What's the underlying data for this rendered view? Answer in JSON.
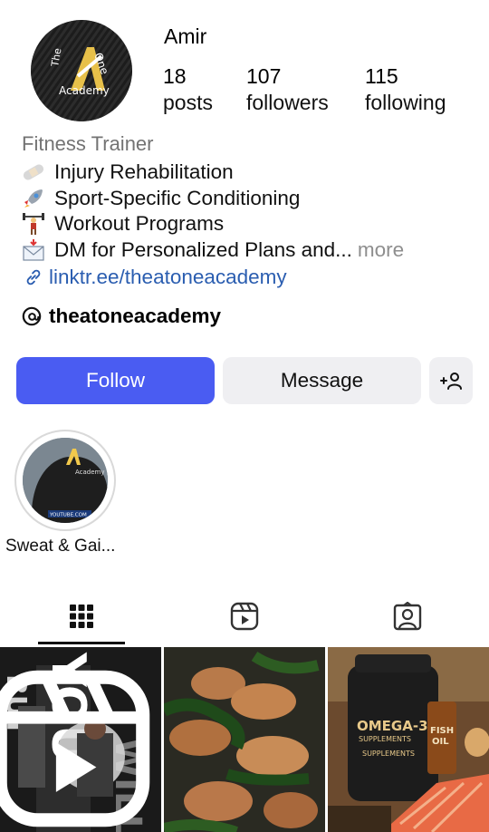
{
  "profile": {
    "username": "Amir",
    "avatar_text": "Academy",
    "avatar_the": "The",
    "avatar_one": "One"
  },
  "stats": {
    "posts_count": "18",
    "posts_label": "posts",
    "followers_count": "107",
    "followers_label": "followers",
    "following_count": "115",
    "following_label": "following"
  },
  "bio": {
    "category": "Fitness Trainer",
    "lines": [
      {
        "icon": "bandage-icon",
        "text": "Injury Rehabilitation"
      },
      {
        "icon": "rocket-icon",
        "text": "Sport-Specific Conditioning"
      },
      {
        "icon": "weightlifter-icon",
        "text": "Workout Programs"
      },
      {
        "icon": "envelope-icon",
        "text": "DM for Personalized Plans and..."
      }
    ],
    "more_label": "more",
    "link": "linktr.ee/theatoneacademy"
  },
  "threads": {
    "handle": "theatoneacademy"
  },
  "actions": {
    "follow_label": "Follow",
    "message_label": "Message",
    "add_user_icon": "add-user-icon"
  },
  "highlights": [
    {
      "label": "Sweat & Gai...",
      "overlay_text": "YOUTUBE.COM"
    }
  ],
  "tabs": [
    {
      "name": "grid-icon"
    },
    {
      "name": "reels-icon"
    },
    {
      "name": "tagged-icon"
    }
  ],
  "posts": [
    {
      "type": "reel",
      "overlay_text": "BUT YOU WILL"
    },
    {
      "type": "image",
      "subject": "chicken and spinach"
    },
    {
      "type": "image",
      "label_1": "OMEGA-3",
      "label_2": "SUPPLEMENTS",
      "label_3": "FISH",
      "label_4": "OIL"
    }
  ],
  "colors": {
    "follow_bg": "#4a5cf2",
    "secondary_bg": "#efeff2",
    "link": "#2a5db0",
    "muted": "#737373"
  }
}
